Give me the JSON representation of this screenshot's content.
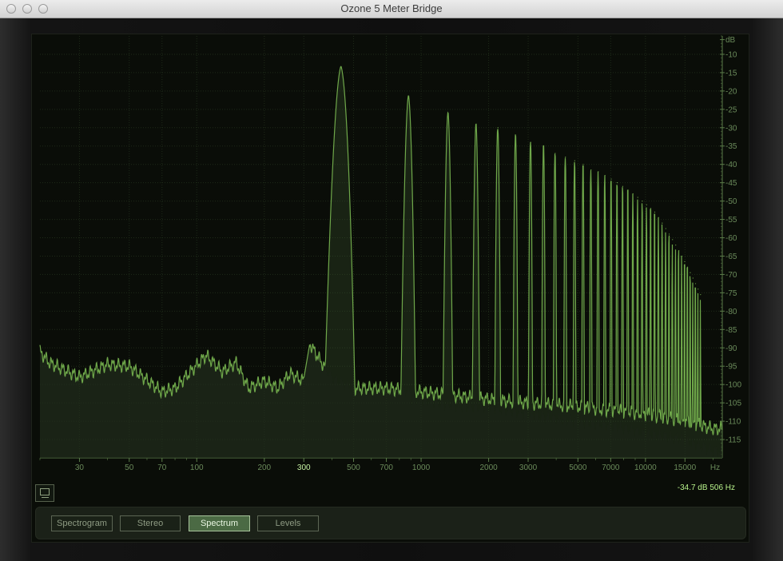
{
  "window": {
    "title": "Ozone 5 Meter Bridge"
  },
  "colors": {
    "trace": "#6fa84a",
    "fill": "#3f5c35",
    "grid": "#1e2a18",
    "axis": "#5a7a48",
    "label": "#6a8a5a"
  },
  "readout": "-34.7 dB 506 Hz",
  "tabs": [
    {
      "label": "Spectrogram",
      "active": false
    },
    {
      "label": "Stereo",
      "active": false
    },
    {
      "label": "Spectrum",
      "active": true
    },
    {
      "label": "Levels",
      "active": false
    }
  ],
  "chart_data": {
    "type": "line",
    "title": "",
    "xlabel": "Hz",
    "ylabel": "dB",
    "xscale": "log",
    "xlim": [
      20,
      22000
    ],
    "ylim": [
      -120,
      -5
    ],
    "grid": true,
    "x_ticks": [
      "30",
      "50",
      "70",
      "100",
      "200",
      "300",
      "500",
      "700",
      "1000",
      "2000",
      "3000",
      "5000",
      "7000",
      "10000",
      "15000",
      "Hz"
    ],
    "y_ticks": [
      "dB",
      "-10",
      "-15",
      "-20",
      "-25",
      "-30",
      "-35",
      "-40",
      "-45",
      "-50",
      "-55",
      "-60",
      "-65",
      "-70",
      "-75",
      "-80",
      "-85",
      "-90",
      "-95",
      "-100",
      "-105",
      "-110",
      "-115"
    ],
    "fundamental_hz": 440,
    "peak_levels_db": [
      -13.5,
      -21.5,
      -26,
      -29,
      -30,
      -32,
      -34,
      -35,
      -37,
      -38,
      -39,
      -40,
      -41.5,
      -42,
      -43,
      -44,
      -45,
      -46,
      -47,
      -48,
      -49,
      -50,
      -51,
      -52,
      -53,
      -54.5,
      -56,
      -57.5,
      -59,
      -60.5,
      -62,
      -63.5,
      -65,
      -66.5,
      -68,
      -69.5,
      -71,
      -72.5,
      -74,
      -75.5
    ],
    "floor_db": [
      [
        20,
        -91
      ],
      [
        22,
        -94
      ],
      [
        30,
        -98
      ],
      [
        40,
        -94.5
      ],
      [
        50,
        -95
      ],
      [
        70,
        -102
      ],
      [
        80,
        -101
      ],
      [
        110,
        -92
      ],
      [
        130,
        -96.5
      ],
      [
        150,
        -94
      ],
      [
        170,
        -101
      ],
      [
        200,
        -99
      ],
      [
        230,
        -101
      ],
      [
        260,
        -97
      ],
      [
        300,
        -99
      ],
      [
        320,
        -89
      ],
      [
        360,
        -94
      ],
      [
        400,
        -98
      ],
      [
        500,
        -101
      ],
      [
        700,
        -101
      ],
      [
        1000,
        -102
      ],
      [
        2000,
        -104
      ],
      [
        3000,
        -105
      ],
      [
        5000,
        -106
      ],
      [
        7000,
        -107
      ],
      [
        10000,
        -108
      ],
      [
        15000,
        -110
      ],
      [
        20000,
        -112
      ]
    ],
    "floor_deep_db": [
      [
        1000,
        -104
      ],
      [
        1500,
        -106
      ],
      [
        2000,
        -106
      ],
      [
        3000,
        -108
      ],
      [
        5000,
        -110
      ],
      [
        7000,
        -111
      ],
      [
        10000,
        -113
      ],
      [
        15000,
        -115
      ],
      [
        20000,
        -118
      ]
    ]
  }
}
